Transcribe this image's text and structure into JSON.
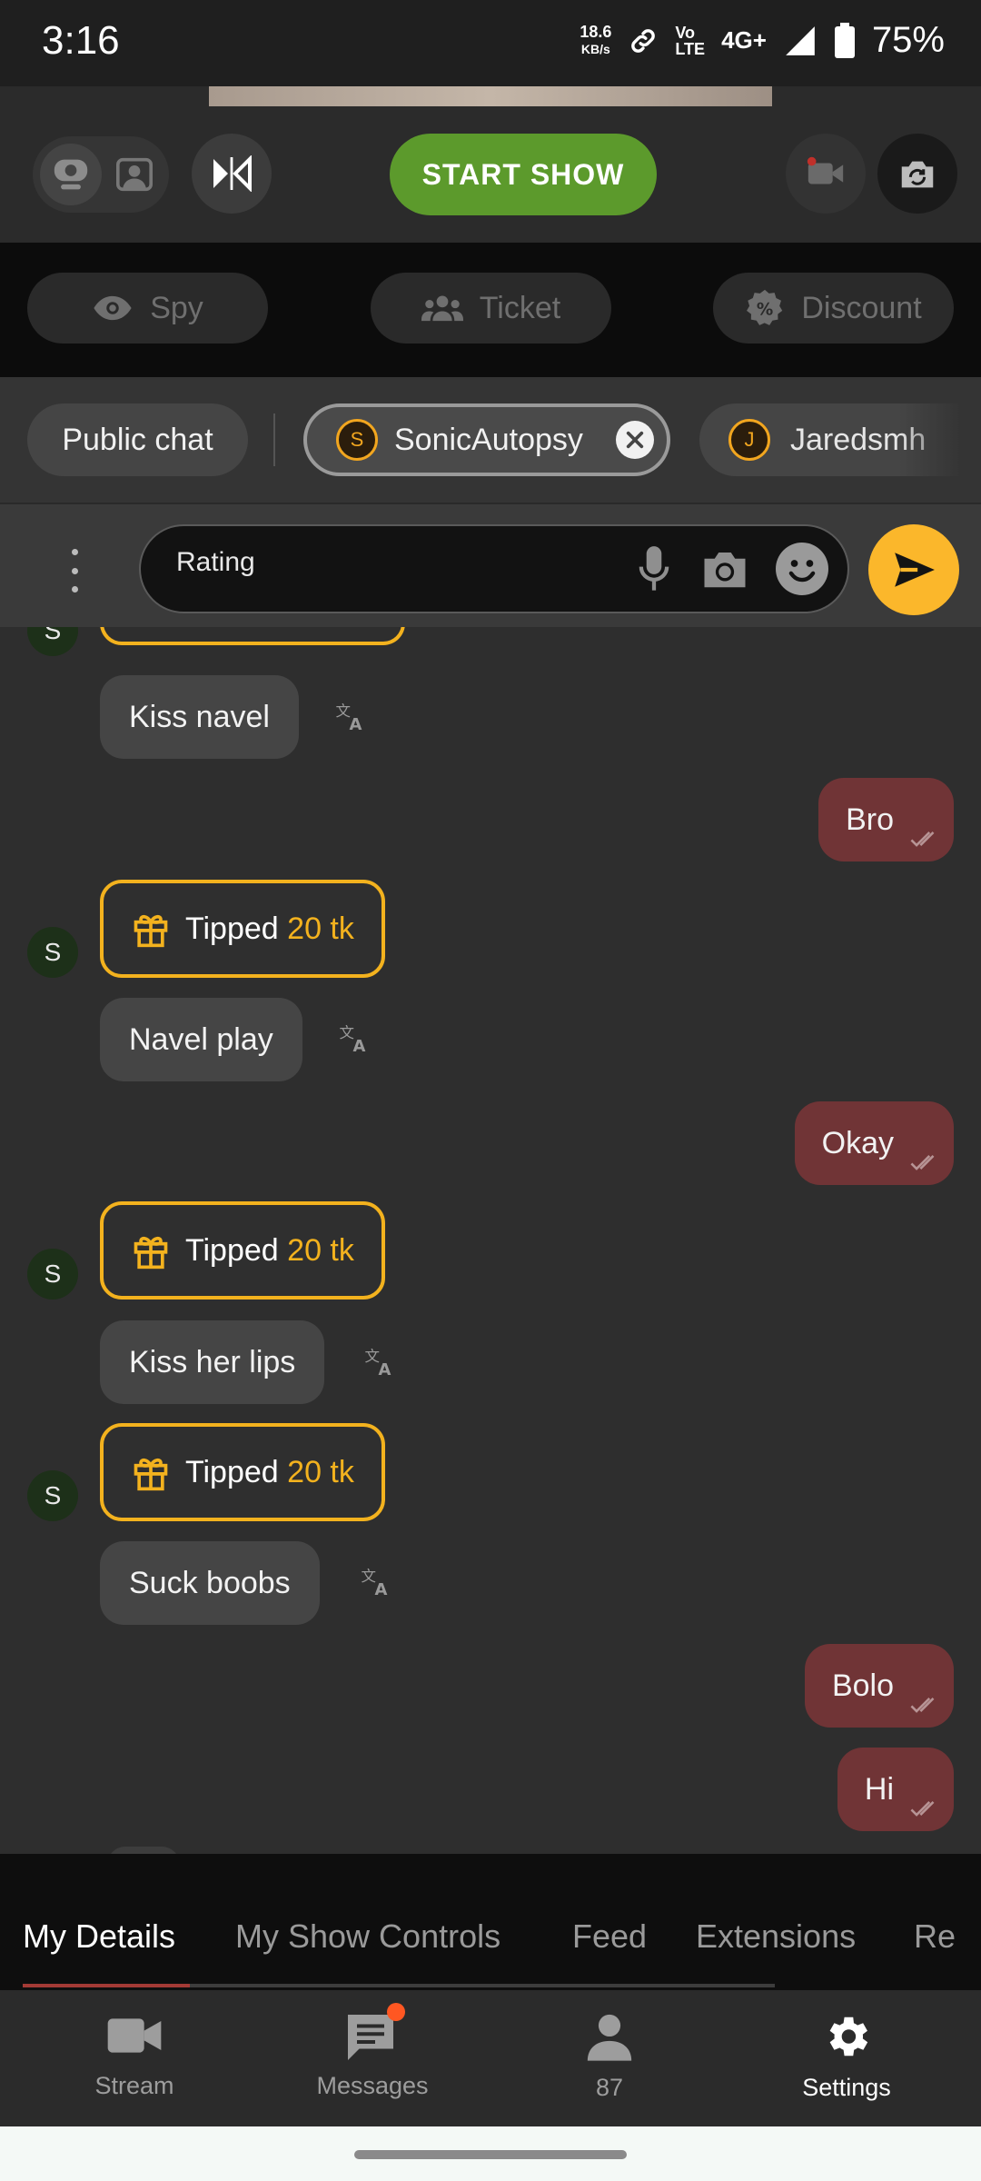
{
  "status_bar": {
    "time": "3:16",
    "net_speed": "18.6",
    "net_unit": "KB/s",
    "volte_top": "Vo",
    "volte_bottom": "LTE",
    "network": "4G+",
    "battery": "75%"
  },
  "controls": {
    "start_show_label": "START SHOW"
  },
  "tools": {
    "spy_label": "Spy",
    "ticket_label": "Ticket",
    "discount_label": "Discount"
  },
  "chat_tabs": {
    "public_label": "Public chat",
    "active_user_initial": "S",
    "active_user": "SonicAutopsy",
    "other_user_initial": "J",
    "other_user": "Jaredsmh"
  },
  "input": {
    "placeholder": "Rating"
  },
  "messages": [
    {
      "kind": "in",
      "text": "Kiss navel"
    },
    {
      "kind": "out",
      "text": "Bro"
    },
    {
      "kind": "tip",
      "sender": "S",
      "label": "Tipped",
      "amount": "20 tk"
    },
    {
      "kind": "in",
      "text": "Navel play"
    },
    {
      "kind": "out",
      "text": "Okay"
    },
    {
      "kind": "tip",
      "sender": "S",
      "label": "Tipped",
      "amount": "20 tk"
    },
    {
      "kind": "in",
      "text": "Kiss her lips"
    },
    {
      "kind": "tip",
      "sender": "S",
      "label": "Tipped",
      "amount": "20 tk"
    },
    {
      "kind": "in",
      "text": "Suck boobs"
    },
    {
      "kind": "out",
      "text": "Bolo"
    },
    {
      "kind": "out",
      "text": "Hi"
    }
  ],
  "top_partial_sender": "S",
  "sub_tabs": [
    "My Details",
    "My Show Controls",
    "Feed",
    "Extensions",
    "Re"
  ],
  "nav": {
    "stream": "Stream",
    "messages": "Messages",
    "count": "87",
    "settings": "Settings"
  },
  "colors": {
    "accent_yellow": "#f3b21e",
    "start_green": "#5c9a2c",
    "outgoing_bubble": "#703436",
    "notification_dot": "#ff5722"
  }
}
